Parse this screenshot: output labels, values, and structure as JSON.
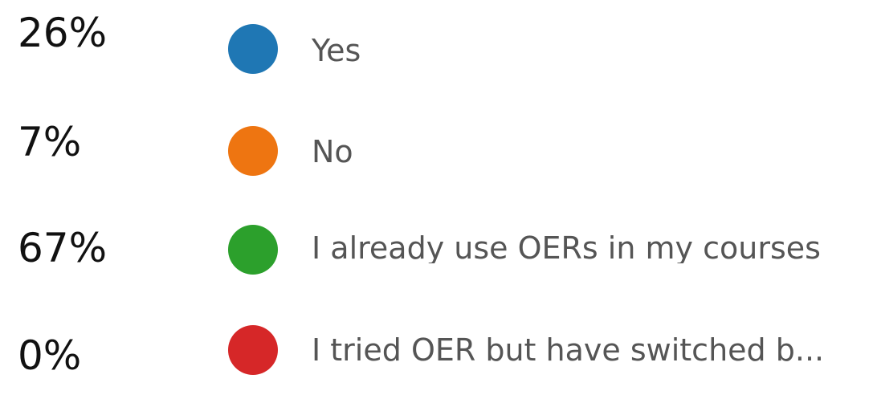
{
  "chart_data": {
    "type": "pie",
    "categories": [
      "Yes",
      "No",
      "I already use OERs in my courses",
      "I tried OER but have switched b..."
    ],
    "values": [
      26,
      7,
      67,
      0
    ],
    "value_labels": [
      "26%",
      "7%",
      "67%",
      "0%"
    ],
    "colors": [
      "#1f77b4",
      "#ee7511",
      "#2ca02c",
      "#d62728"
    ],
    "legend_position": "left"
  }
}
